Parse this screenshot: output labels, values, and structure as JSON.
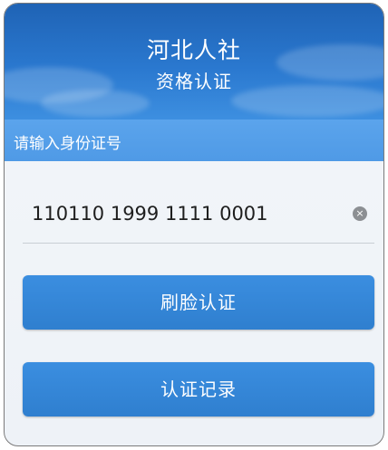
{
  "header": {
    "title": "河北人社",
    "subtitle": "资格认证"
  },
  "id_section": {
    "label": "请输入身份证号",
    "input_value": "110110 1999 1111 0001",
    "clear_icon": "clear-circle-icon",
    "clear_glyph": "×"
  },
  "actions": {
    "face_auth_label": "刷脸认证",
    "records_label": "认证记录"
  },
  "colors": {
    "banner": "#2a78cf",
    "label_bar": "#5ba4ec",
    "button": "#3385d6"
  }
}
